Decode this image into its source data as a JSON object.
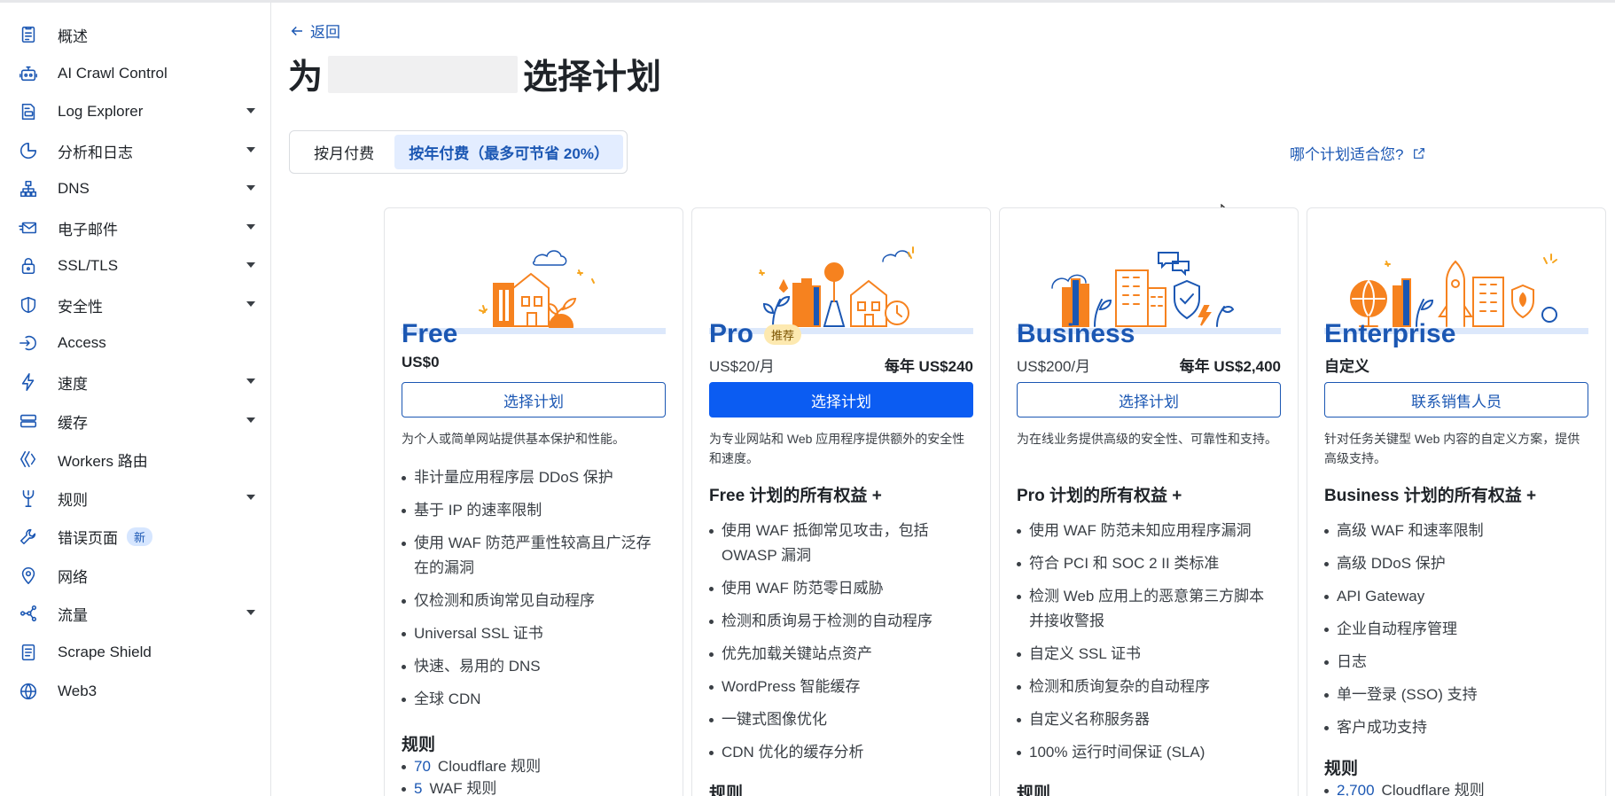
{
  "sidebar": {
    "items": [
      {
        "label": "概述",
        "icon": "document-icon",
        "caret": false
      },
      {
        "label": "AI Crawl Control",
        "icon": "robot-icon",
        "caret": false
      },
      {
        "label": "Log Explorer",
        "icon": "log-icon",
        "caret": true
      },
      {
        "label": "分析和日志",
        "icon": "pie-chart-icon",
        "caret": true
      },
      {
        "label": "DNS",
        "icon": "network-icon",
        "caret": true
      },
      {
        "label": "电子邮件",
        "icon": "mail-icon",
        "caret": true
      },
      {
        "label": "SSL/TLS",
        "icon": "lock-icon",
        "caret": true
      },
      {
        "label": "安全性",
        "icon": "shield-icon",
        "caret": true
      },
      {
        "label": "Access",
        "icon": "access-icon",
        "caret": false
      },
      {
        "label": "速度",
        "icon": "lightning-icon",
        "caret": true
      },
      {
        "label": "缓存",
        "icon": "storage-icon",
        "caret": true
      },
      {
        "label": "Workers 路由",
        "icon": "workers-icon",
        "caret": false
      },
      {
        "label": "规则",
        "icon": "rules-icon",
        "caret": true
      },
      {
        "label": "错误页面",
        "icon": "wrench-icon",
        "caret": false,
        "badge": "新"
      },
      {
        "label": "网络",
        "icon": "location-pin-icon",
        "caret": false
      },
      {
        "label": "流量",
        "icon": "share-nodes-icon",
        "caret": true
      },
      {
        "label": "Scrape Shield",
        "icon": "scrape-document-icon",
        "caret": false
      },
      {
        "label": "Web3",
        "icon": "globe-icon",
        "caret": false
      }
    ]
  },
  "header": {
    "back_label": "返回",
    "title_prefix": "为",
    "title_suffix": "选择计划",
    "help_link": "哪个计划适合您?"
  },
  "billing_toggle": {
    "monthly": "按月付费",
    "yearly": "按年付费（最多可节省 20%）"
  },
  "plans": [
    {
      "name": "Free",
      "price": "US$0",
      "button": "选择计划",
      "description": "为个人或简单网站提供基本保护和性能。",
      "features": [
        "非计量应用程序层 DDoS 保护",
        "基于 IP 的速率限制",
        "使用 WAF 防范严重性较高且广泛存在的漏洞",
        "仅检测和质询常见自动程序",
        "Universal SSL 证书",
        "快速、易用的 DNS",
        "全球 CDN"
      ],
      "rules_heading": "规则",
      "rules": [
        {
          "count": "70",
          "label": "Cloudflare 规则"
        },
        {
          "count": "5",
          "label": "WAF 规则"
        }
      ]
    },
    {
      "name": "Pro",
      "badge": "推荐",
      "price": "US$20/月",
      "annual": "每年 US$240",
      "button": "选择计划",
      "description": "为专业网站和 Web 应用程序提供额外的安全性和速度。",
      "includes": "Free 计划的所有权益 +",
      "features": [
        "使用 WAF 抵御常见攻击，包括 OWASP 漏洞",
        "使用 WAF 防范零日威胁",
        "检测和质询易于检测的自动程序",
        "优先加载关键站点资产",
        "WordPress 智能缓存",
        "一键式图像优化",
        "CDN 优化的缓存分析"
      ],
      "rules_heading": "规则"
    },
    {
      "name": "Business",
      "price": "US$200/月",
      "annual": "每年 US$2,400",
      "button": "选择计划",
      "description": "为在线业务提供高级的安全性、可靠性和支持。",
      "includes": "Pro 计划的所有权益 +",
      "features": [
        "使用 WAF 防范未知应用程序漏洞",
        "符合 PCI 和 SOC 2 II 类标准",
        "检测 Web 应用上的恶意第三方脚本并接收警报",
        "自定义 SSL 证书",
        "检测和质询复杂的自动程序",
        "自定义名称服务器",
        "100% 运行时间保证 (SLA)"
      ],
      "rules_heading": "规则"
    },
    {
      "name": "Enterprise",
      "price": "自定义",
      "button": "联系销售人员",
      "description": "针对任务关键型 Web 内容的自定义方案，提供高级支持。",
      "includes": "Business 计划的所有权益 +",
      "features": [
        "高级 WAF 和速率限制",
        "高级 DDoS 保护",
        "API Gateway",
        "企业自动程序管理",
        "日志",
        "单一登录 (SSO) 支持",
        "客户成功支持"
      ],
      "rules_heading": "规则",
      "rules": [
        {
          "count": "2,700",
          "label": "Cloudflare 规则"
        }
      ]
    }
  ],
  "colors": {
    "accent": "#1b57b3",
    "primary_button": "#0b5cf2",
    "illustration_orange": "#f6821f",
    "badge_bg": "#fde9b0"
  }
}
